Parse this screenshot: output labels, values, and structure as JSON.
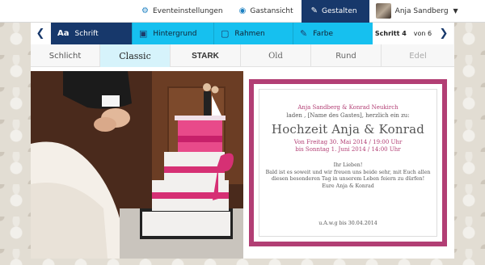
{
  "topbar": {
    "events_label": "Eventeinstellungen",
    "guest_view_label": "Gastansicht",
    "design_label": "Gestalten",
    "user_name": "Anja Sandberg"
  },
  "toolbar": {
    "font_label": "Schrift",
    "font_icon_text": "Aa",
    "background_label": "Hintergrund",
    "frame_label": "Rahmen",
    "color_label": "Farbe",
    "step_prefix": "Schritt 4",
    "step_suffix": "von 6"
  },
  "style_tabs": [
    "Schlicht",
    "Classic",
    "STARK",
    "Old",
    "Rund",
    "Edel"
  ],
  "selected_style": "Classic",
  "invitation": {
    "names": "Anja Sandberg & Konrad Neukirch",
    "invite_line": "laden , [Name des Gastes], herzlich ein zu:",
    "title": "Hochzeit Anja & Konrad",
    "from_prefix": "Von",
    "from_date": "Freitag 30. Mai 2014 / 19:00 Uhr",
    "to_prefix": "bis",
    "to_date": "Sonntag 1. Juni 2014 / 14:00 Uhr",
    "greeting": "Ihr Lieben!",
    "body_line1": "Bald ist es soweit und wir freuen uns beide sehr, mit Euch allen",
    "body_line2": "diesen besonderen Tag in unserem Leben feiern zu dürfen!",
    "sign_off": "Eure Anja & Konrad",
    "rsvp": "u.A.w.g bis 30.04.2014"
  },
  "colors": {
    "navy": "#17386b",
    "cyan": "#16c0ef",
    "accent_pink": "#b23e74"
  }
}
